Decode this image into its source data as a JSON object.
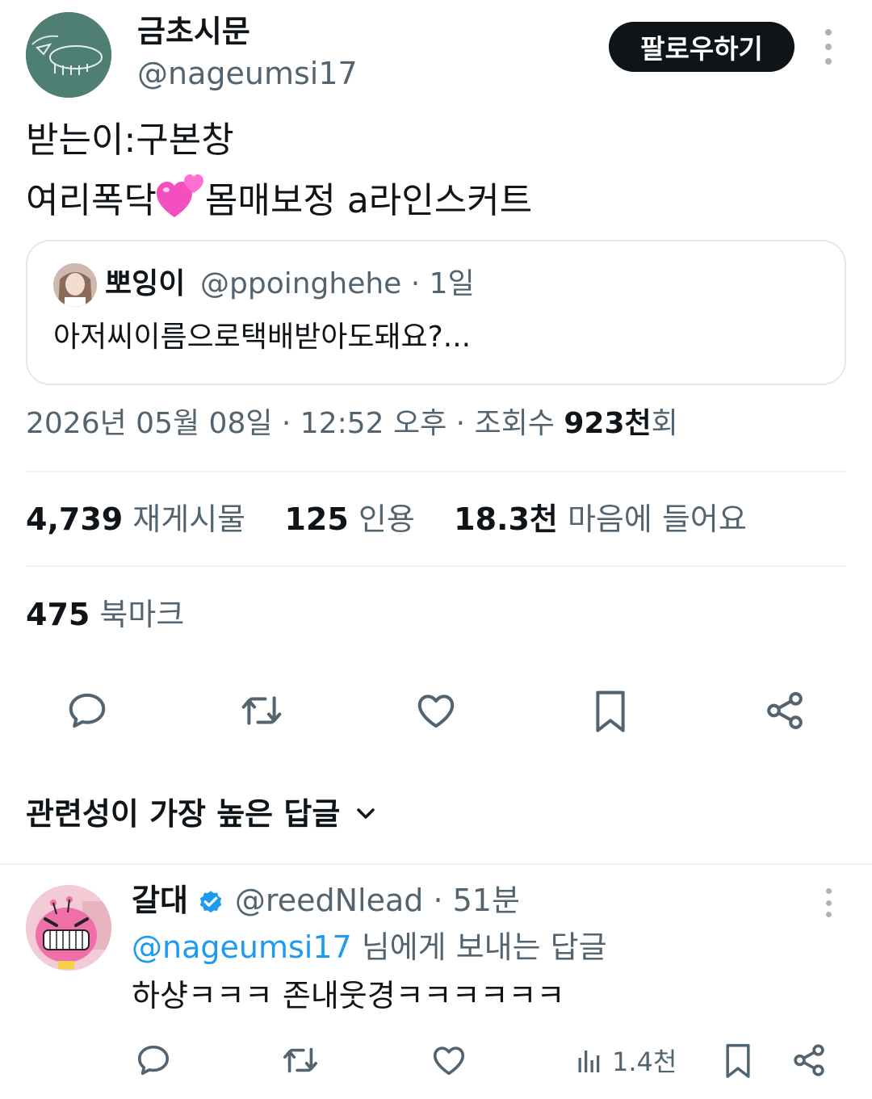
{
  "tweet": {
    "author": {
      "display_name": "금초시문",
      "handle": "@nageumsi17"
    },
    "follow_label": "팔로우하기",
    "text_line1": "받는이:구본창",
    "text_line2_before": "여리폭닥",
    "text_line2_after": "몸매보정 a라인스커트",
    "emoji": "two-hearts-emoji",
    "quote": {
      "name": "뽀잉이",
      "meta": "@ppoinghehe · 1일",
      "text": "아저씨이름으로택배받아도돼요?..."
    },
    "timestamp": {
      "date_time": "2026년 05월 08일 · 12:52 오후 · 조회수 ",
      "views": "923천",
      "views_suffix": "회"
    },
    "stats": {
      "reposts_count": "4,739",
      "reposts_label": "재게시물",
      "quotes_count": "125",
      "quotes_label": "인용",
      "likes_count": "18.3천",
      "likes_label": "마음에 들어요"
    },
    "bookmarks": {
      "count": "475",
      "label": "북마크"
    },
    "actions": [
      "reply-icon",
      "repost-icon",
      "like-icon",
      "bookmark-icon",
      "share-icon"
    ]
  },
  "replies_sort_label": "관련성이 가장 높은 답글",
  "reply": {
    "name": "갈대",
    "meta": "@reedNlead · 51분",
    "mention": "@nageumsi17",
    "to_suffix": " 님에게 보내는 답글",
    "text": "하샹ㅋㅋㅋ 존내웃경ㅋㅋㅋㅋㅋㅋ",
    "views": "1.4천"
  },
  "colors": {
    "text": "#0f1419",
    "secondary": "#536471",
    "accent": "#1d9bf0",
    "divider": "#eff3f4",
    "icon": "#536471"
  }
}
